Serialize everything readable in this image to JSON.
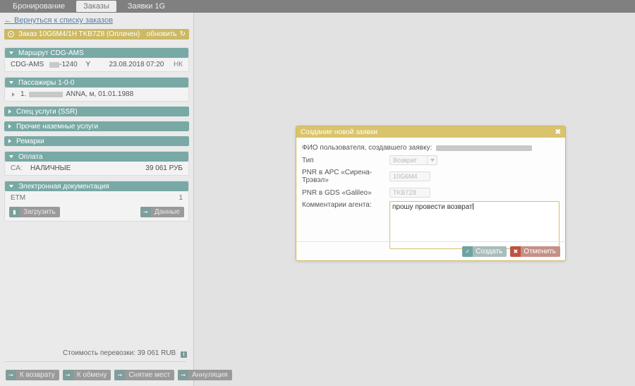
{
  "topnav": {
    "tabs": [
      {
        "label": "Бронирование",
        "active": false
      },
      {
        "label": "Заказы",
        "active": true
      },
      {
        "label": "Заявки 1G",
        "active": false
      }
    ]
  },
  "left": {
    "back_link": "← Вернуться к списку заказов",
    "order_bar": {
      "icon": "clock-icon",
      "title": "Заказ 10G6M4/1H TKB7Z8 (Оплачен)",
      "refresh_label": "обновить",
      "refresh_icon": "refresh-icon",
      "color": "#cdb964"
    },
    "sections": {
      "route": {
        "header": "Маршрут  CDG-AMS",
        "row": {
          "segment": "CDG-AMS",
          "flight_redacted": true,
          "flight": "-1240",
          "class": "Y",
          "datetime": "23.08.2018 07:20",
          "status": "НК"
        }
      },
      "passengers": {
        "header": "Пассажиры 1-0-0",
        "row": {
          "num": "1.",
          "name_redacted": true,
          "name": "ANNA, м, 01.01.1988"
        }
      },
      "ssr": {
        "header": "Спец услуги (SSR)"
      },
      "ground": {
        "header": "Прочие наземные услуги"
      },
      "remarks": {
        "header": "Ремарки"
      },
      "payment": {
        "header": "Оплата",
        "row": {
          "label": "CA:",
          "method": "НАЛИЧНЫЕ",
          "amount": "39 061 РУБ"
        }
      },
      "edocs": {
        "header": "Электронная документация",
        "row": {
          "label": "ETM",
          "count": "1"
        },
        "buttons": [
          {
            "label": "Загрузить",
            "icon": "upload-icon"
          },
          {
            "label": "Данные",
            "icon": "arrow-right-icon"
          }
        ]
      }
    },
    "cost": {
      "label": "Стоимость перевозки:",
      "value": "39 061 RUB",
      "info_icon": "info-icon"
    },
    "actions": [
      {
        "label": "К возврату",
        "icon": "arrow-right-icon"
      },
      {
        "label": "К обмену",
        "icon": "arrow-right-icon"
      },
      {
        "label": "Снятие мест",
        "icon": "arrow-right-icon"
      },
      {
        "label": "Аннуляция",
        "icon": "arrow-right-icon"
      }
    ]
  },
  "modal": {
    "title": "Создание новой заявки",
    "close_icon": "close-icon",
    "accent_color": "#d9c36b",
    "fields": {
      "creator_label": "ФИО пользователя, создавшего заявку:",
      "creator_value_redacted": true,
      "type_label": "Тип",
      "type_value": "Возврат",
      "type_options": [
        "Возврат"
      ],
      "pnr_arc_label": "PNR в АРС «Сирена-Трэвэл»",
      "pnr_arc_value": "10G6M4",
      "pnr_gds_label": "PNR в GDS «Galileo»",
      "pnr_gds_value": "TKB7Z8",
      "comment_label": "Комментарии агента:",
      "comment_value": "прошу провести возврат"
    },
    "buttons": {
      "create": {
        "label": "Создать",
        "icon": "check-icon"
      },
      "cancel": {
        "label": "Отменить",
        "icon": "close-icon"
      }
    }
  }
}
